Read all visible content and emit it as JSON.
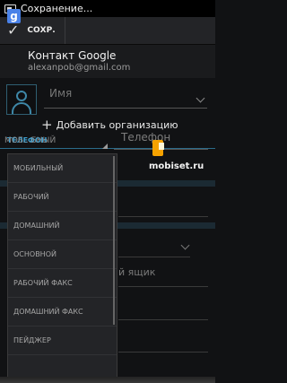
{
  "statusbar": {
    "title": "Сохранение..."
  },
  "actionbar": {
    "done_label": "СОХР."
  },
  "account": {
    "title": "Контакт Google",
    "email": "alexanpob@gmail.com",
    "logo_letter": "g"
  },
  "name": {
    "placeholder": "Имя"
  },
  "organization": {
    "add_label": "Добавить организацию"
  },
  "phone_section": {
    "header": "ТЕЛЕФОН",
    "type_value": "МОБ...БНЫЙ",
    "placeholder": "Телефон"
  },
  "watermark": {
    "text": "mobiset.ru"
  },
  "background_fields": {
    "mailbox_partial": "й ящик"
  },
  "dropdown": {
    "options": [
      "МОБИЛЬНЫЙ",
      "РАБОЧИЙ",
      "ДОМАШНИЙ",
      "ОСНОВНОЙ",
      "РАБОЧИЙ ФАКС",
      "ДОМАШНИЙ ФАКС",
      "ПЕЙДЖЕР",
      ""
    ]
  },
  "colors": {
    "accent": "#3fa0cf",
    "background": "#111214",
    "dropdown_bg": "#232427"
  },
  "icons": [
    "status-save-icon",
    "check-icon",
    "google-icon",
    "avatar-icon",
    "chevron-down-icon",
    "plus-icon",
    "corner-triangle-icon",
    "mobiset-logo-icon"
  ]
}
